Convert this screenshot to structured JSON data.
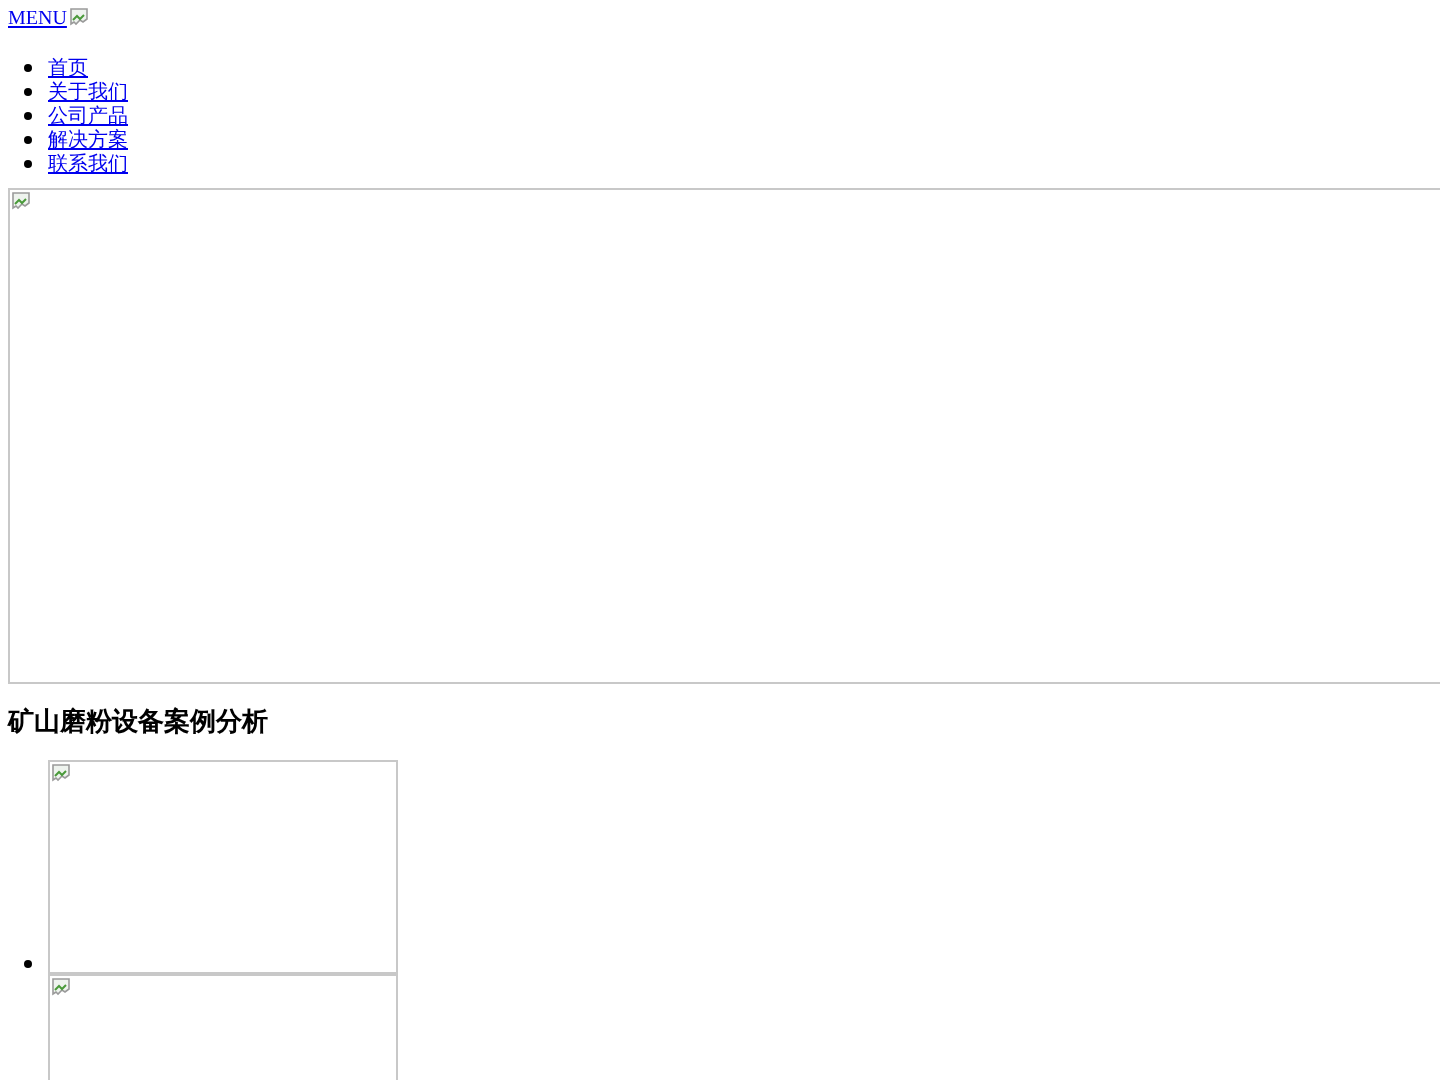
{
  "menu": {
    "label": "MENU"
  },
  "nav": {
    "items": [
      {
        "label": "首页"
      },
      {
        "label": "关于我们"
      },
      {
        "label": "公司产品"
      },
      {
        "label": "解决方案"
      },
      {
        "label": "联系我们"
      }
    ]
  },
  "banner": {
    "kind": "broken-image"
  },
  "section": {
    "title": "矿山磨粉设备案例分析",
    "cases": [
      {
        "kind": "broken-image"
      },
      {
        "kind": "broken-image"
      }
    ]
  }
}
